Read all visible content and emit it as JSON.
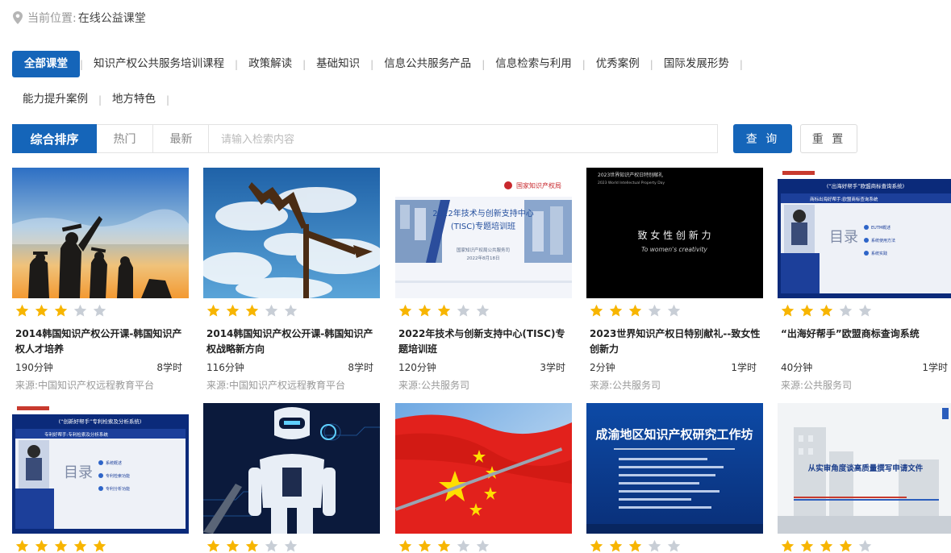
{
  "breadcrumb": {
    "prefix": "当前位置:",
    "current": "在线公益课堂"
  },
  "categories": {
    "row1": [
      "全部课堂",
      "知识产权公共服务培训课程",
      "政策解读",
      "基础知识",
      "信息公共服务产品",
      "信息检索与利用",
      "优秀案例",
      "国际发展形势"
    ],
    "row2": [
      "能力提升案例",
      "地方特色"
    ],
    "active_index": 0
  },
  "sort": {
    "tabs": [
      "综合排序",
      "热门",
      "最新"
    ],
    "active_index": 0
  },
  "search": {
    "placeholder": "请输入检索内容",
    "query_label": "查 询",
    "reset_label": "重 置"
  },
  "colors": {
    "accent": "#1565b9",
    "star_on": "#f7b500",
    "star_off": "#c8ced6"
  },
  "courses": [
    {
      "title": "2014韩国知识产权公开课-韩国知识产权人才培养",
      "duration": "190分钟",
      "hours": "8学时",
      "source": "来源:中国知识产权远程教育平台",
      "rating": 3,
      "thumb": "graduates"
    },
    {
      "title": "2014韩国知识产权公开课-韩国知识产权战略新方向",
      "duration": "116分钟",
      "hours": "8学时",
      "source": "来源:中国知识产权远程教育平台",
      "rating": 3,
      "thumb": "windvane"
    },
    {
      "title": "2022年技术与创新支持中心(TISC)专题培训班",
      "duration": "120分钟",
      "hours": "3学时",
      "source": "来源:公共服务司",
      "rating": 3,
      "thumb": "tisc",
      "thumb_text": {
        "logo": "国家知识产权局",
        "line1": "2022年技术与创新支持中心",
        "line2": "(TISC)专题培训班",
        "org": "国家知识产权局公共服务司",
        "date": "2022年8月18日"
      }
    },
    {
      "title": "2023世界知识产权日特别献礼--致女性创新力",
      "duration": "2分钟",
      "hours": "1学时",
      "source": "来源:公共服务司",
      "rating": 3,
      "thumb": "women",
      "thumb_text": {
        "top1": "2023世界知识产权日特别献礼",
        "top2": "2023 World Intellectual Property Day",
        "main": "致 女 性 创 新 力",
        "sub": "To women's creativity"
      }
    },
    {
      "title": "“出海好帮手”欧盟商标查询系统",
      "duration": "40分钟",
      "hours": "1学时",
      "source": "来源:公共服务司",
      "rating": 3,
      "thumb": "eutm",
      "thumb_text": {
        "banner": "(“出海好帮手”欧盟商标查询系统)",
        "head": "商标出海好帮手:欧盟商标查询系统",
        "toc": "目录",
        "items": [
          "EUTM概述",
          "系统使用方法",
          "系统实践"
        ]
      }
    },
    {
      "title": "",
      "duration": "",
      "hours": "",
      "source": "",
      "rating": 5,
      "thumb": "patent",
      "thumb_text": {
        "banner": "(“创新好帮手”专利检索及分析系统)",
        "head": "专利好帮手:专利检索及分析系统",
        "toc": "目录",
        "items": [
          "系统概述",
          "专利检索功能",
          "专利分析功能"
        ]
      }
    },
    {
      "title": "",
      "duration": "",
      "hours": "",
      "source": "",
      "rating": 3,
      "thumb": "robot"
    },
    {
      "title": "",
      "duration": "",
      "hours": "",
      "source": "",
      "rating": 3,
      "thumb": "flag"
    },
    {
      "title": "",
      "duration": "",
      "hours": "",
      "source": "",
      "rating": 3,
      "thumb": "chengyu",
      "thumb_text": {
        "main": "成渝地区知识产权研究工作坊"
      }
    },
    {
      "title": "",
      "duration": "",
      "hours": "",
      "source": "",
      "rating": 4,
      "thumb": "building",
      "thumb_text": {
        "main": "从实审角度谈高质量撰写申请文件"
      }
    }
  ]
}
